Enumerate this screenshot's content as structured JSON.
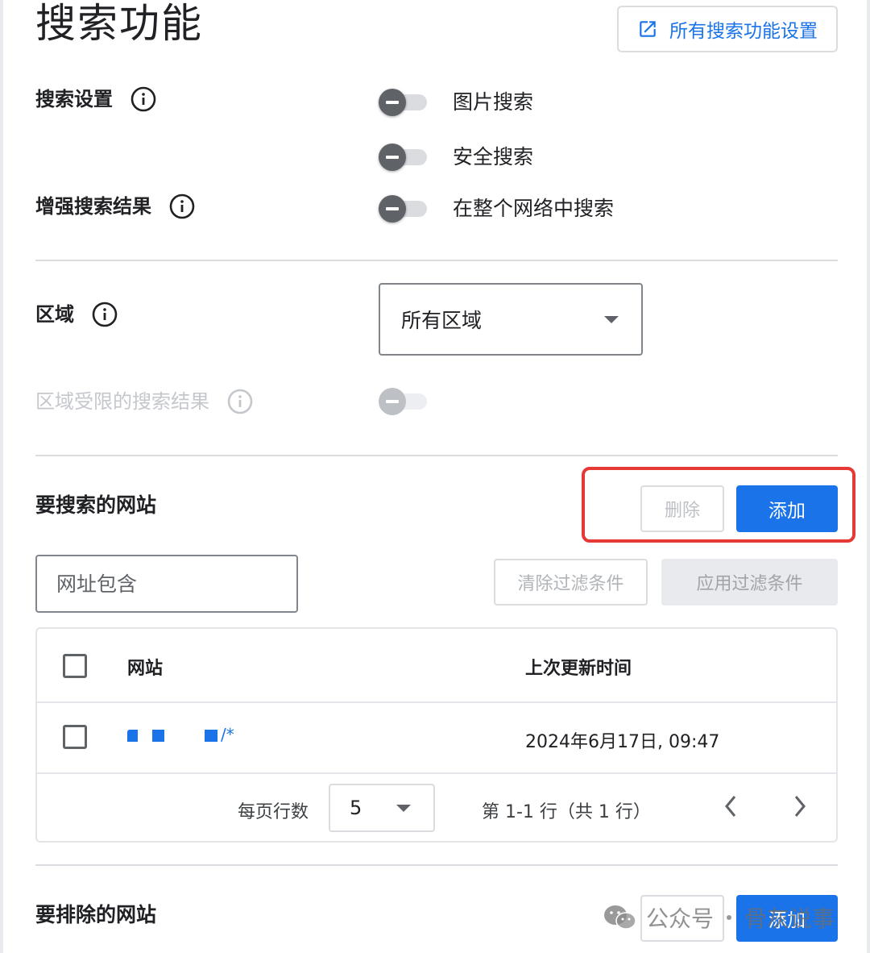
{
  "header": {
    "title": "搜索功能",
    "all_settings_label": "所有搜索功能设置",
    "all_settings_icon": "open-in-new-icon"
  },
  "search_settings": {
    "label": "搜索设置",
    "toggles": [
      {
        "label": "图片搜索",
        "enabled": false
      },
      {
        "label": "安全搜索",
        "enabled": false
      }
    ]
  },
  "enhanced_results": {
    "label": "增强搜索结果",
    "toggle": {
      "label": "在整个网络中搜索",
      "enabled": false
    }
  },
  "region": {
    "label": "区域",
    "selected": "所有区域"
  },
  "region_restricted": {
    "label": "区域受限的搜索结果",
    "disabled": true
  },
  "sites_to_search": {
    "title": "要搜索的网站",
    "delete_label": "删除",
    "add_label": "添加",
    "filter_placeholder": "网址包含",
    "clear_filter_label": "清除过滤条件",
    "apply_filter_label": "应用过滤条件",
    "table": {
      "columns": [
        "网站",
        "上次更新时间"
      ],
      "rows": [
        {
          "site_suffix": "/*",
          "updated": "2024年6月17日, 09:47"
        }
      ]
    },
    "pagination": {
      "rows_per_page_label": "每页行数",
      "rows_per_page": "5",
      "range_label": "第 1-1 行（共 1 行）"
    }
  },
  "sites_to_exclude": {
    "title": "要排除的网站",
    "add_label": "添加"
  },
  "watermark": {
    "prefix": "公众号",
    "name": "骨灰说事"
  },
  "colors": {
    "accent": "#1a73e8",
    "highlight": "#e53935",
    "toggle_off": "#5f6368"
  }
}
